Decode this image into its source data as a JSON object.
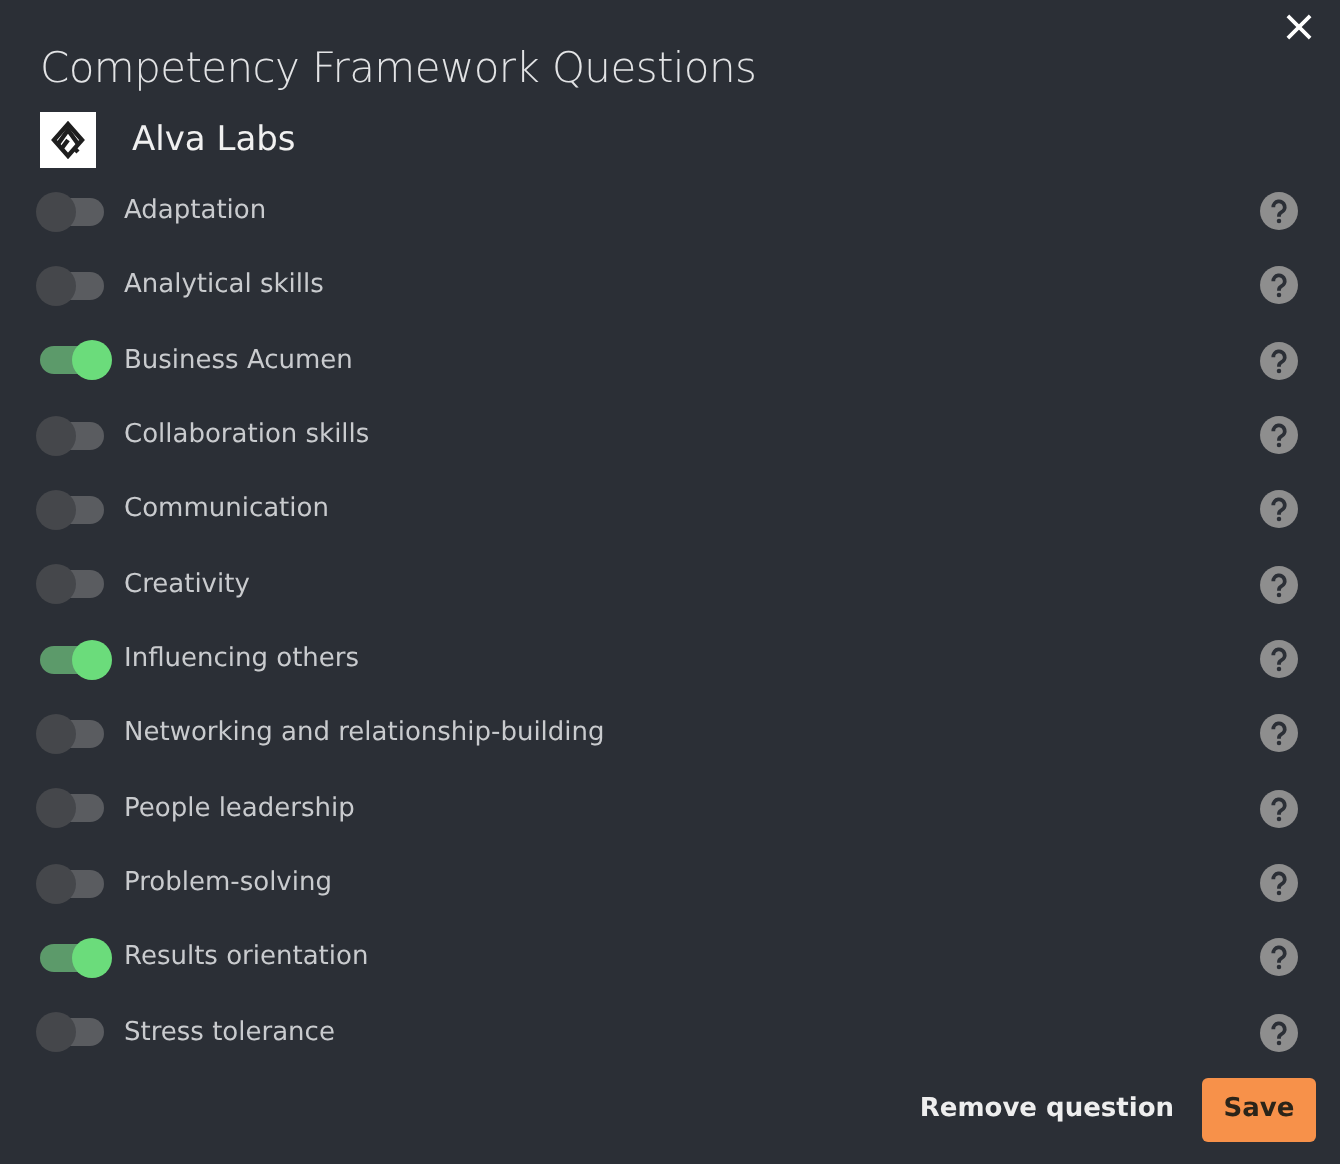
{
  "dialog": {
    "title": "Competency Framework Questions",
    "company": "Alva Labs"
  },
  "questions": [
    {
      "label": "Adaptation",
      "on": false
    },
    {
      "label": "Analytical skills",
      "on": false
    },
    {
      "label": "Business Acumen",
      "on": true
    },
    {
      "label": "Collaboration skills",
      "on": false
    },
    {
      "label": "Communication",
      "on": false
    },
    {
      "label": "Creativity",
      "on": false
    },
    {
      "label": "Influencing others",
      "on": true
    },
    {
      "label": "Networking and relationship-building",
      "on": false
    },
    {
      "label": "People leadership",
      "on": false
    },
    {
      "label": "Problem-solving",
      "on": false
    },
    {
      "label": "Results orientation",
      "on": true
    },
    {
      "label": "Stress tolerance",
      "on": false
    }
  ],
  "buttons": {
    "remove": "Remove question",
    "save": "Save"
  }
}
